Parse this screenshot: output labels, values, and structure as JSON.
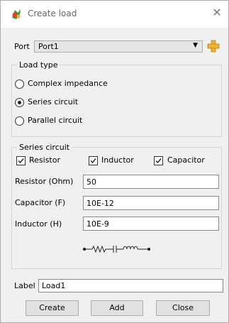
{
  "window": {
    "title": "Create load",
    "close_glyph": "✕"
  },
  "port": {
    "label": "Port",
    "value": "Port1",
    "dropdown_icon": "triangle-down",
    "add_icon": "add-port-icon"
  },
  "load_type": {
    "legend": "Load type",
    "options": [
      "Complex impedance",
      "Series circuit",
      "Parallel circuit"
    ],
    "selected": "Series circuit"
  },
  "series_circuit": {
    "legend": "Series circuit",
    "checks": [
      {
        "label": "Resistor",
        "checked": true
      },
      {
        "label": "Inductor",
        "checked": true
      },
      {
        "label": "Capacitor",
        "checked": true
      }
    ],
    "fields": [
      {
        "label": "Resistor (Ohm)",
        "value": "50"
      },
      {
        "label": "Capacitor (F)",
        "value": "10E-12"
      },
      {
        "label": "Inductor (H)",
        "value": "10E-9"
      }
    ],
    "schematic_icon": "series-rlc-schematic"
  },
  "label_field": {
    "label": "Label",
    "value": "Load1"
  },
  "buttons": {
    "create": "Create",
    "add": "Add",
    "close": "Close"
  },
  "colors": {
    "accent_plus": "#f0b232",
    "app_icon_green": "#3a9a3a",
    "app_icon_red": "#d9452e"
  }
}
